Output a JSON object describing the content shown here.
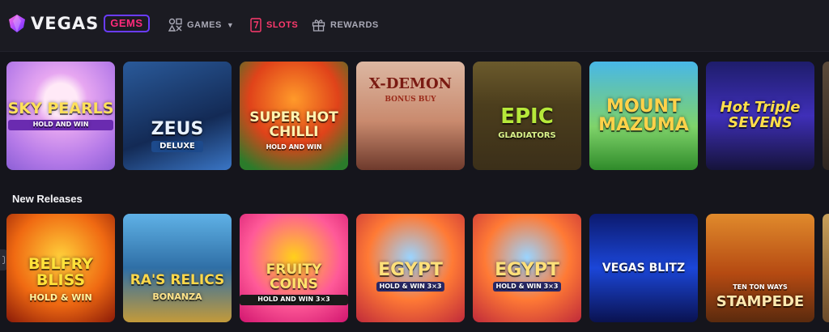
{
  "header": {
    "logo_text": "VEGAS",
    "logo_badge": "GEMS",
    "nav": [
      {
        "label": "GAMES",
        "icon": "shapes-icon"
      },
      {
        "label": "SLOTS",
        "icon": "seven-icon",
        "active": true
      },
      {
        "label": "REWARDS",
        "icon": "gift-icon"
      }
    ]
  },
  "colors": {
    "background": "#15151c",
    "accent": "#ff3a6e",
    "badge_border": "#6a3cff"
  },
  "featured": {
    "games": [
      {
        "title": "SKY PEARLS",
        "sub": "HOLD AND WIN"
      },
      {
        "title": "ZEUS",
        "sub": "DELUXE"
      },
      {
        "title": "SUPER HOT CHILLI",
        "sub": "HOLD AND WIN"
      },
      {
        "title": "X-DEMON",
        "sub": "BONUS BUY"
      },
      {
        "title": "EPIC",
        "sub": "GLADIATORS"
      },
      {
        "title": "MOUNT MAZUMA",
        "sub": ""
      },
      {
        "title": "Hot Triple SEVENS",
        "sub": ""
      }
    ]
  },
  "new_releases": {
    "title": "New Releases",
    "games": [
      {
        "title": "BELFRY BLISS",
        "sub": "HOLD & WIN"
      },
      {
        "title": "RA'S RELICS",
        "sub": "BONANZA"
      },
      {
        "title": "FRUITY COINS",
        "sub": "HOLD AND WIN 3×3"
      },
      {
        "title": "EGYPT",
        "sub": "HOLD & WIN 3×3"
      },
      {
        "title": "EGYPT",
        "sub": "HOLD & WIN 3×3"
      },
      {
        "title": "VEGAS BLITZ",
        "sub": ""
      },
      {
        "title": "STAMPEDE",
        "sub": "TEN TON WAYS"
      }
    ]
  }
}
